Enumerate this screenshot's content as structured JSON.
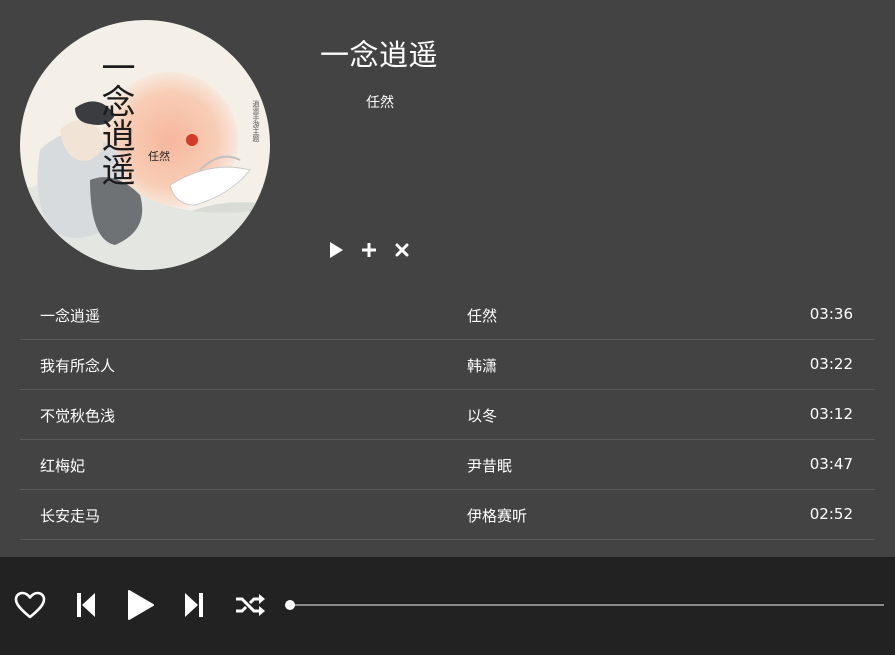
{
  "song": {
    "title": "一念逍遥",
    "artist": "任然",
    "cover_text": {
      "calligraphy": "一念逍遥",
      "artist": "任然",
      "tag": "逍遥手游主题"
    }
  },
  "actions": [
    {
      "icon": "play-icon"
    },
    {
      "icon": "plus-icon"
    },
    {
      "icon": "close-icon"
    }
  ],
  "tracks": [
    {
      "title": "一念逍遥",
      "artist": "任然",
      "duration": "03:36"
    },
    {
      "title": "我有所念人",
      "artist": "韩潇",
      "duration": "03:22"
    },
    {
      "title": "不觉秋色浅",
      "artist": "以冬",
      "duration": "03:12"
    },
    {
      "title": "红梅妃",
      "artist": "尹昔眠",
      "duration": "03:47"
    },
    {
      "title": "长安走马",
      "artist": "伊格赛听",
      "duration": "02:52"
    }
  ],
  "player": {
    "controls": [
      "heart-icon",
      "previous-icon",
      "play-icon",
      "next-icon",
      "shuffle-icon"
    ],
    "progress": 0
  },
  "colors": {
    "background": "#434343",
    "player_bar": "#222222",
    "divider": "#5a5a5a",
    "text": "#ffffff"
  }
}
